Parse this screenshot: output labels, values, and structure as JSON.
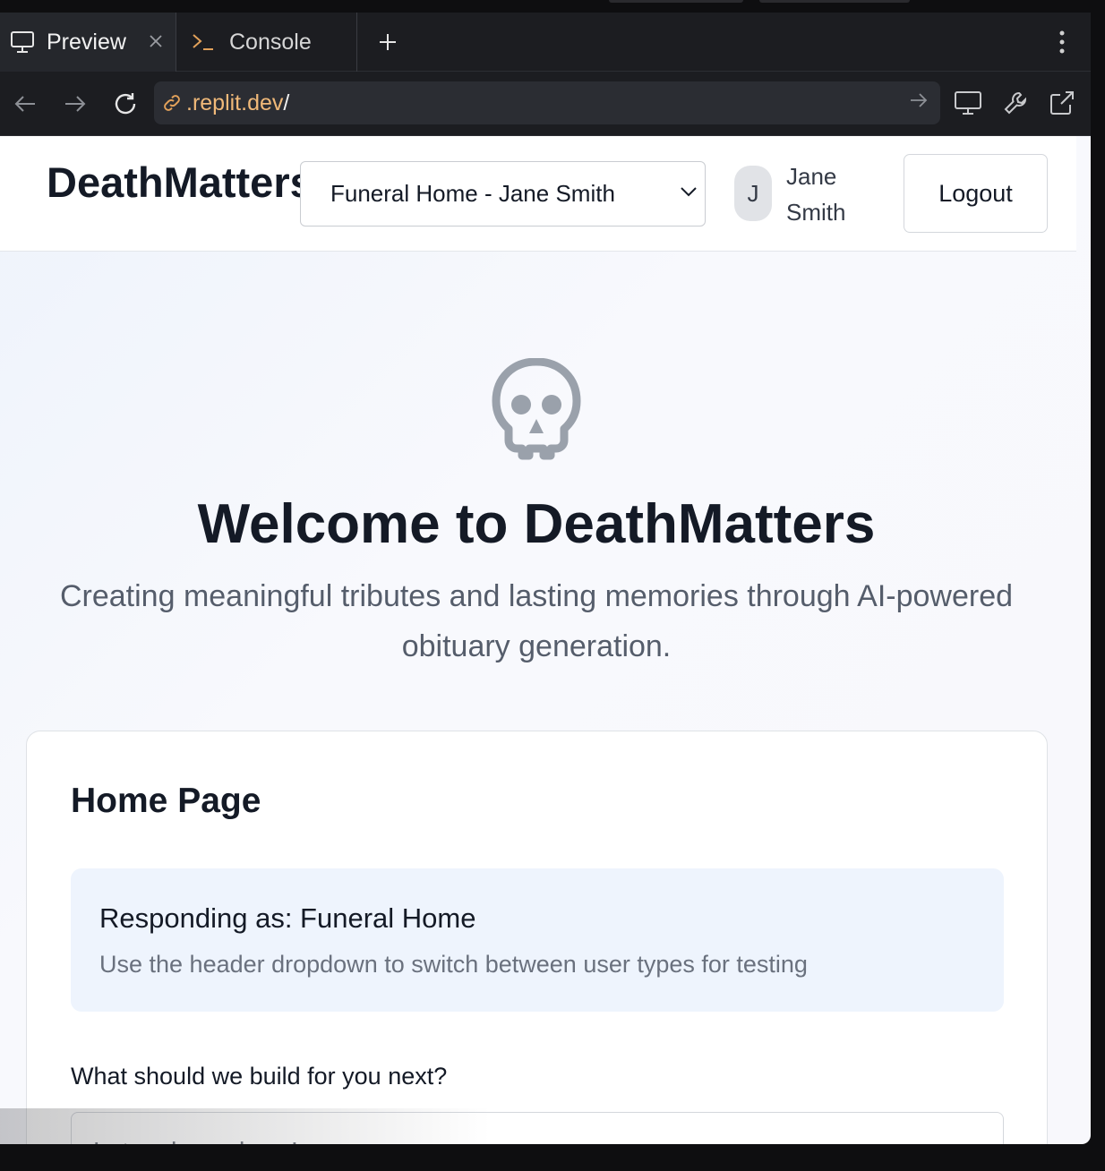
{
  "browser": {
    "tabs": [
      {
        "label": "Preview",
        "icon": "monitor-icon",
        "active": true
      },
      {
        "label": "Console",
        "icon": "terminal-icon",
        "active": false
      }
    ],
    "new_tab_icon": "plus-icon",
    "menu_icon": "more-vertical-icon",
    "url_host": ".replit.dev",
    "url_path": "/",
    "accent": "#f0b979"
  },
  "site": {
    "brand": "DeathMatters",
    "user_select": {
      "selected": "Funeral Home - Jane Smith"
    },
    "user": {
      "initial": "J",
      "name": "Jane Smith"
    },
    "logout_label": "Logout"
  },
  "hero": {
    "icon": "skull-icon",
    "title": "Welcome to DeathMatters",
    "subtitle": "Creating meaningful tributes and lasting memories through AI-powered obituary generation."
  },
  "card": {
    "title": "Home Page",
    "info_title": "Responding as: Funeral Home",
    "info_text": "Use the header dropdown to switch between user types for testing",
    "question_label": "What should we build for you next?",
    "input_placeholder": "Let us know here!"
  }
}
